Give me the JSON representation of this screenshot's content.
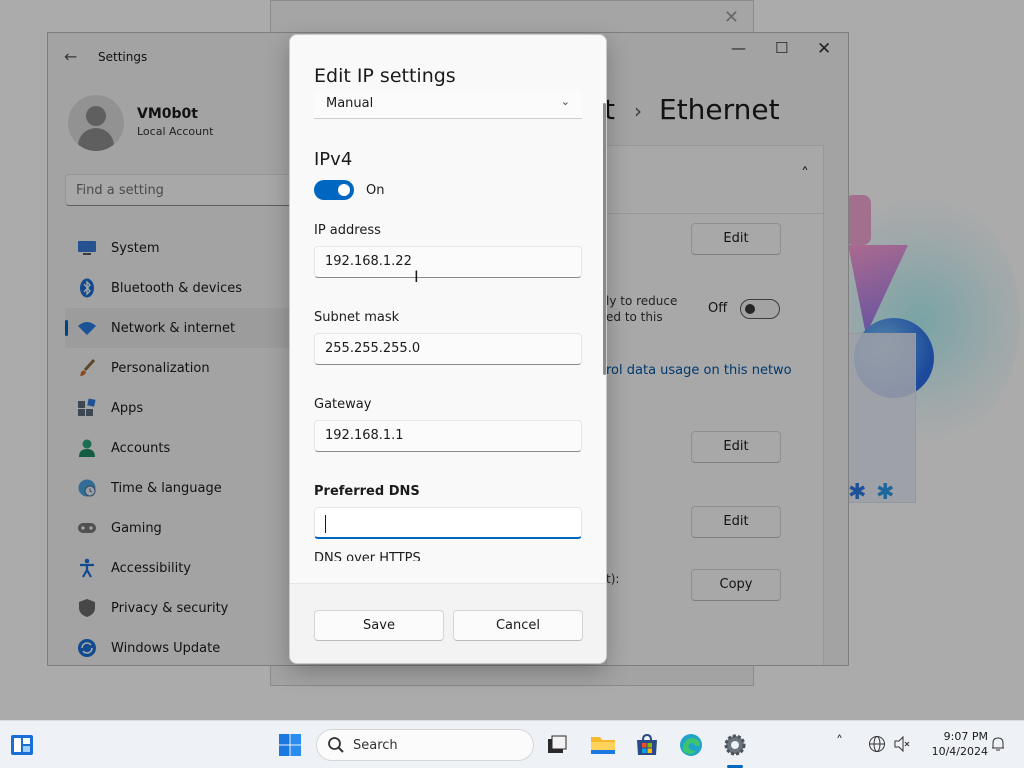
{
  "background_window": {
    "close_glyph": "✕"
  },
  "settings": {
    "app_title": "Settings",
    "user": {
      "name": "VM0b0t",
      "account_type": "Local Account"
    },
    "search_placeholder": "Find a setting",
    "nav": [
      {
        "label": "System",
        "icon": "monitor-icon"
      },
      {
        "label": "Bluetooth & devices",
        "icon": "bluetooth-icon"
      },
      {
        "label": "Network & internet",
        "icon": "wifi-icon",
        "active": true
      },
      {
        "label": "Personalization",
        "icon": "brush-icon"
      },
      {
        "label": "Apps",
        "icon": "apps-icon"
      },
      {
        "label": "Accounts",
        "icon": "person-icon"
      },
      {
        "label": "Time & language",
        "icon": "globe-clock-icon"
      },
      {
        "label": "Gaming",
        "icon": "gamepad-icon"
      },
      {
        "label": "Accessibility",
        "icon": "accessibility-icon"
      },
      {
        "label": "Privacy & security",
        "icon": "shield-icon"
      },
      {
        "label": "Windows Update",
        "icon": "update-icon"
      }
    ],
    "breadcrumb": {
      "prefix": "t",
      "separator": "›",
      "title": "Ethernet"
    },
    "content": {
      "edit_label": "Edit",
      "metered_text_line1": "ly to reduce",
      "metered_text_line2": "ed to this",
      "metered_toggle_label": "Off",
      "data_usage_link": "rol data usage on this netwo",
      "copy_label": "Copy",
      "partial_text": "t):"
    }
  },
  "dialog": {
    "title": "Edit IP settings",
    "mode_value": "Manual",
    "ipv4_heading": "IPv4",
    "ipv4_toggle": "On",
    "fields": [
      {
        "label": "IP address",
        "value": "192.168.1.22"
      },
      {
        "label": "Subnet mask",
        "value": "255.255.255.0"
      },
      {
        "label": "Gateway",
        "value": "192.168.1.1"
      },
      {
        "label": "Preferred DNS",
        "value": ""
      }
    ],
    "dns_over_https_label": "DNS over HTTPS",
    "save_label": "Save",
    "cancel_label": "Cancel"
  },
  "taskbar": {
    "search_label": "Search",
    "time": "9:07 PM",
    "date": "10/4/2024"
  },
  "colors": {
    "accent": "#0067c0",
    "link": "#0054a6"
  }
}
